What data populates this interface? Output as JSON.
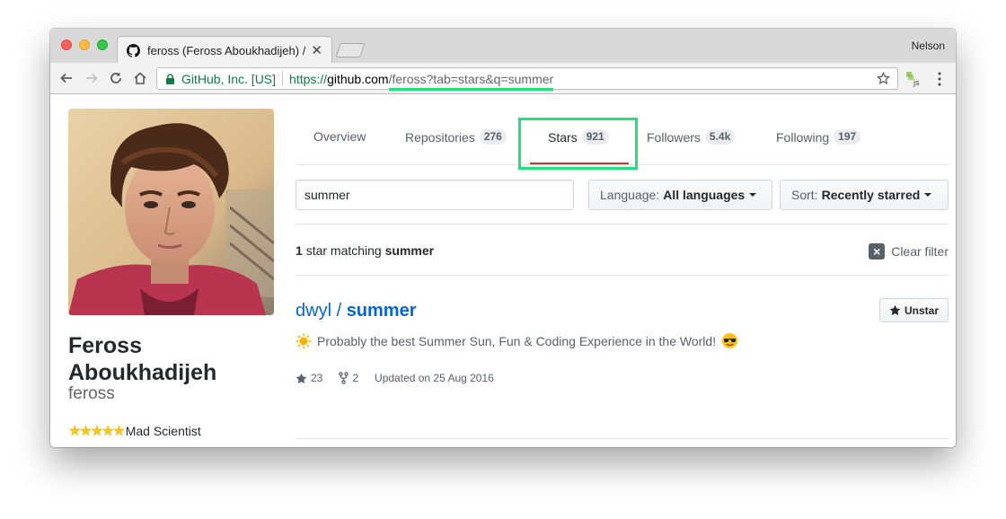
{
  "browser": {
    "tab_title": "feross (Feross Aboukhadijeh) /",
    "profile_name": "Nelson",
    "secure_label": "GitHub, Inc. [US]",
    "url_scheme": "https://",
    "url_host": "github.com",
    "url_path": "/feross?tab=stars&q=summer",
    "extension_label": "js"
  },
  "profile": {
    "full_name": "Feross Aboukhadijeh",
    "username": "feross",
    "bio_stars": "★★★★★",
    "bio": "Mad Scientist"
  },
  "nav": {
    "overview": "Overview",
    "repositories": "Repositories",
    "repositories_count": "276",
    "stars": "Stars",
    "stars_count": "921",
    "followers": "Followers",
    "followers_count": "5.4k",
    "following": "Following",
    "following_count": "197"
  },
  "filter": {
    "query": "summer",
    "language_label": "Language:",
    "language_value": "All languages",
    "sort_label": "Sort:",
    "sort_value": "Recently starred"
  },
  "results": {
    "count": "1",
    "text": "star matching",
    "term": "summer",
    "clear_filter": "Clear filter"
  },
  "repo": {
    "owner": "dwyl",
    "separator": " / ",
    "name": "summer",
    "description": "Probably the best Summer Sun, Fun & Coding Experience in the World!",
    "stars": "23",
    "forks": "2",
    "updated": "Updated on 25 Aug 2016",
    "unstar_label": "Unstar"
  },
  "colors": {
    "highlight": "#22e07b",
    "link": "#0366d6",
    "secure": "#0b8043"
  }
}
